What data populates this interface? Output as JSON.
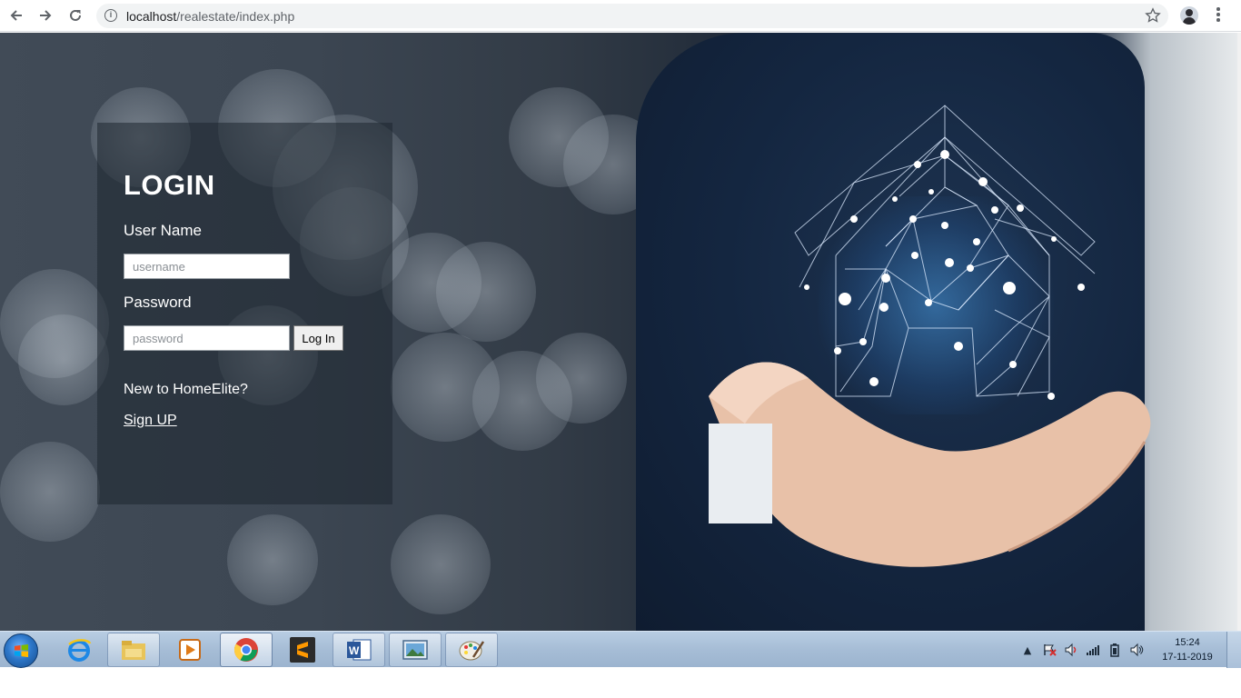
{
  "browser": {
    "url_host": "localhost",
    "url_path": "/realestate/index.php",
    "icons": [
      "back-arrow-icon",
      "forward-arrow-icon",
      "reload-icon",
      "info-icon",
      "star-icon",
      "profile-avatar",
      "menu-dots-icon"
    ]
  },
  "login": {
    "title": "LOGIN",
    "username_label": "User Name",
    "username_placeholder": "username",
    "password_label": "Password",
    "password_placeholder": "password",
    "login_button": "Log In",
    "new_user_text": "New to HomeElite?",
    "signup_link": "Sign UP"
  },
  "taskbar": {
    "apps": [
      "start-orb",
      "internet-explorer-icon",
      "file-explorer-icon",
      "media-player-icon",
      "chrome-icon",
      "sublime-text-icon",
      "word-icon",
      "photo-viewer-icon",
      "paint-icon"
    ],
    "tray_icons": [
      "show-hidden-icons-arrow",
      "action-center-flag-icon",
      "volume-icon",
      "network-signal-icon",
      "battery-icon",
      "speaker-icon"
    ],
    "time": "15:24",
    "date": "17-11-2019"
  },
  "colors": {
    "accent_blue": "#1a73e8",
    "taskbar": "#a6bdd6",
    "panel": "rgba(30,38,48,0.55)"
  }
}
